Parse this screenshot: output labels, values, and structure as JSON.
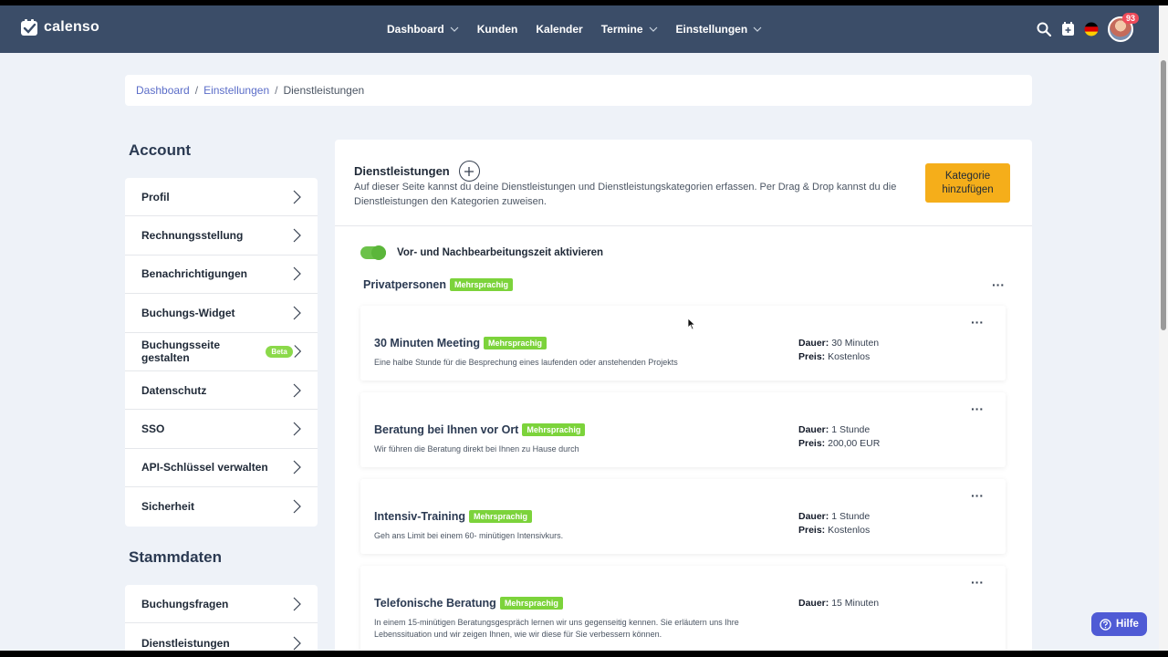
{
  "app": {
    "name": "calenso"
  },
  "nav": {
    "items": [
      {
        "label": "Dashboard",
        "dropdown": true
      },
      {
        "label": "Kunden",
        "dropdown": false
      },
      {
        "label": "Kalender",
        "dropdown": false
      },
      {
        "label": "Termine",
        "dropdown": true
      },
      {
        "label": "Einstellungen",
        "dropdown": true
      }
    ],
    "notification_count": "93"
  },
  "breadcrumb": {
    "items": [
      "Dashboard",
      "Einstellungen"
    ],
    "current": "Dienstleistungen",
    "separator": "/"
  },
  "sidebar": {
    "account_title": "Account",
    "account_items": [
      {
        "label": "Profil"
      },
      {
        "label": "Rechnungsstellung"
      },
      {
        "label": "Benachrichtigungen"
      },
      {
        "label": "Buchungs-Widget"
      },
      {
        "label": "Buchungsseite gestalten",
        "badge": "Beta"
      },
      {
        "label": "Datenschutz"
      },
      {
        "label": "SSO"
      },
      {
        "label": "API-Schlüssel verwalten"
      },
      {
        "label": "Sicherheit"
      }
    ],
    "stammdaten_title": "Stammdaten",
    "stammdaten_items": [
      {
        "label": "Buchungsfragen"
      },
      {
        "label": "Dienstleistungen"
      }
    ]
  },
  "main": {
    "title": "Dienstleistungen",
    "description": "Auf dieser Seite kannst du deine Dienstleistungen und Dienstleistungskategorien erfassen. Per Drag & Drop kannst du die Dienstleistungen den Kategorien zuweisen.",
    "add_category_label": "Kategorie hinzufügen",
    "toggle_label": "Vor- und Nachbearbeitungszeit aktivieren",
    "category": {
      "name": "Privatpersonen",
      "tag": "Mehrsprachig"
    },
    "duration_label": "Dauer:",
    "price_label": "Preis:",
    "services": [
      {
        "title": "30 Minuten Meeting",
        "tag": "Mehrsprachig",
        "description": "Eine halbe Stunde für die Besprechung eines laufenden oder anstehenden Projekts",
        "duration": "30 Minuten",
        "price": "Kostenlos"
      },
      {
        "title": "Beratung bei Ihnen vor Ort",
        "tag": "Mehrsprachig",
        "description": "Wir führen die Beratung direkt bei Ihnen zu Hause durch",
        "duration": "1 Stunde",
        "price": "200,00 EUR"
      },
      {
        "title": "Intensiv-Training",
        "tag": "Mehrsprachig",
        "description": "Geh ans Limit bei einem 60- minütigen Intensivkurs.",
        "duration": "1 Stunde",
        "price": "Kostenlos"
      },
      {
        "title": "Telefonische Beratung",
        "tag": "Mehrsprachig",
        "description": "In einem 15-minütigen Beratungsgespräch lernen wir uns gegenseitig kennen. Sie erläutern uns Ihre Lebenssituation und wir zeigen Ihnen, wie wir diese für Sie verbessern können.",
        "duration": "15 Minuten",
        "price": null
      }
    ]
  },
  "help": {
    "label": "Hilfe"
  },
  "colors": {
    "navbar": "#3b4d68",
    "accent": "#5b6dc8",
    "orange": "#f5ae1a",
    "green": "#7cd33b",
    "help": "#4f5bd5"
  }
}
